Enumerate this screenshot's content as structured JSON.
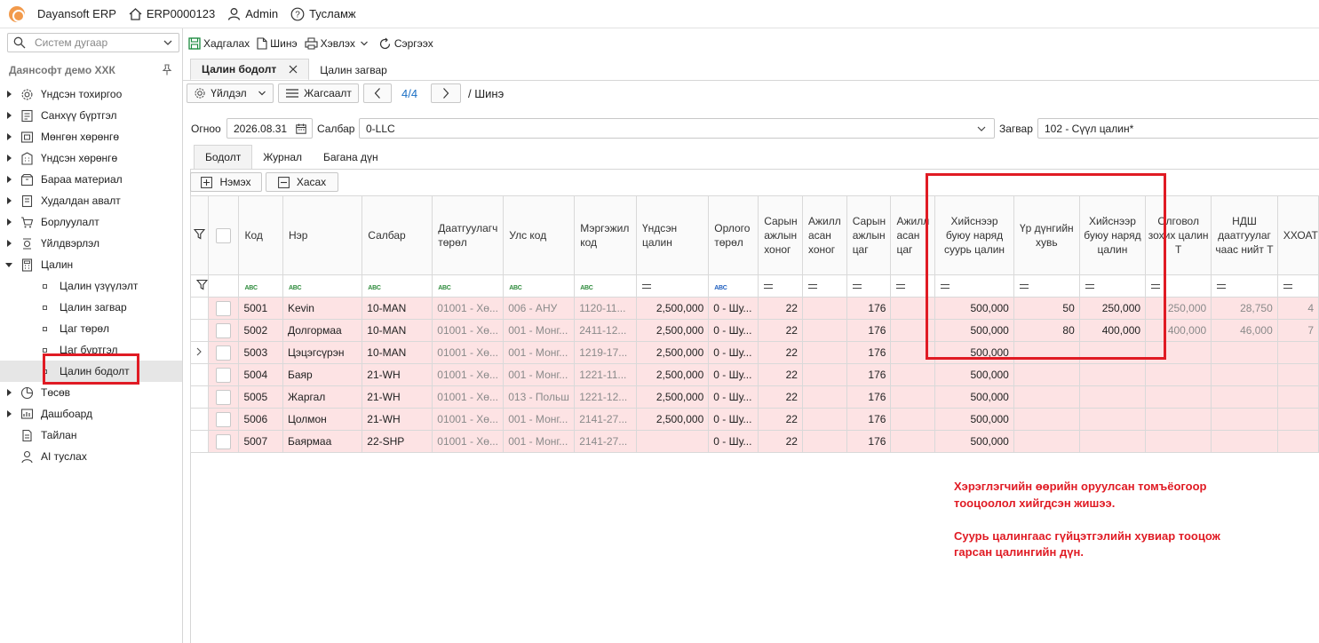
{
  "titlebar": {
    "app_name": "Dayansoft ERP",
    "db_code": "ERP0000123",
    "user": "Admin",
    "help": "Тусламж"
  },
  "sidebar": {
    "search_placeholder": "Систем дугаар",
    "company": "Даянсофт демо ХХК",
    "items": [
      {
        "label": "Үндсэн тохиргоо",
        "icon": "gear-icon"
      },
      {
        "label": "Санхүү бүртгэл",
        "icon": "ledger-icon"
      },
      {
        "label": "Мөнгөн хөрөнгө",
        "icon": "money-icon"
      },
      {
        "label": "Үндсэн хөрөнгө",
        "icon": "building-icon"
      },
      {
        "label": "Бараа материал",
        "icon": "box-icon"
      },
      {
        "label": "Худалдан авалт",
        "icon": "purchase-icon"
      },
      {
        "label": "Борлуулалт",
        "icon": "cart-icon"
      },
      {
        "label": "Үйлдвэрлэл",
        "icon": "factory-icon"
      },
      {
        "label": "Цалин",
        "icon": "calculator-icon"
      }
    ],
    "payroll_children": [
      {
        "label": "Цалин үзүүлэлт"
      },
      {
        "label": "Цалин загвар"
      },
      {
        "label": "Цаг төрөл"
      },
      {
        "label": "Цаг бүртгэл"
      },
      {
        "label": "Цалин бодолт"
      }
    ],
    "items_after": [
      {
        "label": "Төсөв",
        "icon": "pie-icon"
      },
      {
        "label": "Дашбоард",
        "icon": "dashboard-icon"
      },
      {
        "label": "Тайлан",
        "icon": "report-icon"
      },
      {
        "label": "AI туслах",
        "icon": "ai-icon"
      }
    ]
  },
  "toolbar": {
    "save": "Хадгалах",
    "new": "Шинэ",
    "print": "Хэвлэх",
    "refresh": "Сэргээх"
  },
  "tabs": [
    {
      "label": "Цалин бодолт"
    },
    {
      "label": "Цалин загвар"
    }
  ],
  "doc_toolbar": {
    "actions": "Үйлдэл",
    "list": "Жагсаалт",
    "pager": "4/4",
    "status": "/ Шинэ"
  },
  "form": {
    "date_label": "Огноо",
    "date_value": "2026.08.31",
    "branch_label": "Салбар",
    "branch_value": "0-LLC",
    "template_label": "Загвар",
    "template_value": "102 - Сүүл цалин*"
  },
  "subtabs": [
    {
      "label": "Бодолт"
    },
    {
      "label": "Журнал"
    },
    {
      "label": "Багана дүн"
    }
  ],
  "grid_buttons": {
    "add": "Нэмэх",
    "remove": "Хасах"
  },
  "grid": {
    "columns": [
      "Код",
      "Нэр",
      "Салбар",
      "Даатгуулагч төрөл",
      "Улс код",
      "Мэргэжил код",
      "Үндсэн цалин",
      "Орлого төрөл",
      "Сарын ажлын хоног",
      "Ажилл асан хоног",
      "Сарын ажлын цаг",
      "Ажилл асан цаг",
      "Хийснээр буюу наряд суурь цалин",
      "Үр дүнгийн хувь",
      "Хийснээр буюу наряд цалин",
      "Олговол зохих цалин Т",
      "НДШ даатгуулаг чаас нийт Т",
      "ХХОАТ"
    ],
    "rows": [
      {
        "code": "5001",
        "name": "Kevin",
        "branch": "10-MAN",
        "ins": "01001 - Хө...",
        "country": "006 - АНУ",
        "prof": "1120-11...",
        "base": "2,500,000",
        "income": "0 - Шу...",
        "mdays": "22",
        "wdays": "",
        "mhours": "176",
        "whours": "",
        "piece_base": "500,000",
        "perf": "50",
        "piece": "250,000",
        "payable": "250,000",
        "ndsh": "28,750",
        "tax": "4"
      },
      {
        "code": "5002",
        "name": "Долгормаа",
        "branch": "10-MAN",
        "ins": "01001 - Хө...",
        "country": "001 - Монг...",
        "prof": "2411-12...",
        "base": "2,500,000",
        "income": "0 - Шу...",
        "mdays": "22",
        "wdays": "",
        "mhours": "176",
        "whours": "",
        "piece_base": "500,000",
        "perf": "80",
        "piece": "400,000",
        "payable": "400,000",
        "ndsh": "46,000",
        "tax": "7"
      },
      {
        "code": "5003",
        "name": "Цэцэгсүрэн",
        "branch": "10-MAN",
        "ins": "01001 - Хө...",
        "country": "001 - Монг...",
        "prof": "1219-17...",
        "base": "2,500,000",
        "income": "0 - Шу...",
        "mdays": "22",
        "wdays": "",
        "mhours": "176",
        "whours": "",
        "piece_base": "500,000",
        "perf": "",
        "piece": "",
        "payable": "",
        "ndsh": "",
        "tax": ""
      },
      {
        "code": "5004",
        "name": "Баяр",
        "branch": "21-WH",
        "ins": "01001 - Хө...",
        "country": "001 - Монг...",
        "prof": "1221-11...",
        "base": "2,500,000",
        "income": "0 - Шу...",
        "mdays": "22",
        "wdays": "",
        "mhours": "176",
        "whours": "",
        "piece_base": "500,000",
        "perf": "",
        "piece": "",
        "payable": "",
        "ndsh": "",
        "tax": ""
      },
      {
        "code": "5005",
        "name": "Жаргал",
        "branch": "21-WH",
        "ins": "01001 - Хө...",
        "country": "013 - Польш",
        "prof": "1221-12...",
        "base": "2,500,000",
        "income": "0 - Шу...",
        "mdays": "22",
        "wdays": "",
        "mhours": "176",
        "whours": "",
        "piece_base": "500,000",
        "perf": "",
        "piece": "",
        "payable": "",
        "ndsh": "",
        "tax": ""
      },
      {
        "code": "5006",
        "name": "Цолмон",
        "branch": "21-WH",
        "ins": "01001 - Хө...",
        "country": "001 - Монг...",
        "prof": "2141-27...",
        "base": "2,500,000",
        "income": "0 - Шу...",
        "mdays": "22",
        "wdays": "",
        "mhours": "176",
        "whours": "",
        "piece_base": "500,000",
        "perf": "",
        "piece": "",
        "payable": "",
        "ndsh": "",
        "tax": ""
      },
      {
        "code": "5007",
        "name": "Баярмаа",
        "branch": "22-SHP",
        "ins": "01001 - Хө...",
        "country": "001 - Монг...",
        "prof": "2141-27...",
        "base": "",
        "income": "0 - Шу...",
        "mdays": "22",
        "wdays": "",
        "mhours": "176",
        "whours": "",
        "piece_base": "500,000",
        "perf": "",
        "piece": "",
        "payable": "",
        "ndsh": "",
        "tax": ""
      }
    ]
  },
  "annotation": {
    "line1": "Хэрэглэгчийн өөрийн оруулсан томъёогоор тооцоолол хийгдсэн жишээ.",
    "line2": "Суурь цалингаас гүйцэтгэлийн хувиар тооцож гарсан цалингийн дүн."
  },
  "colors": {
    "row_highlight": "#fde3e4",
    "annotation_red": "#e01b24",
    "pager_blue": "#1a6fc4"
  }
}
